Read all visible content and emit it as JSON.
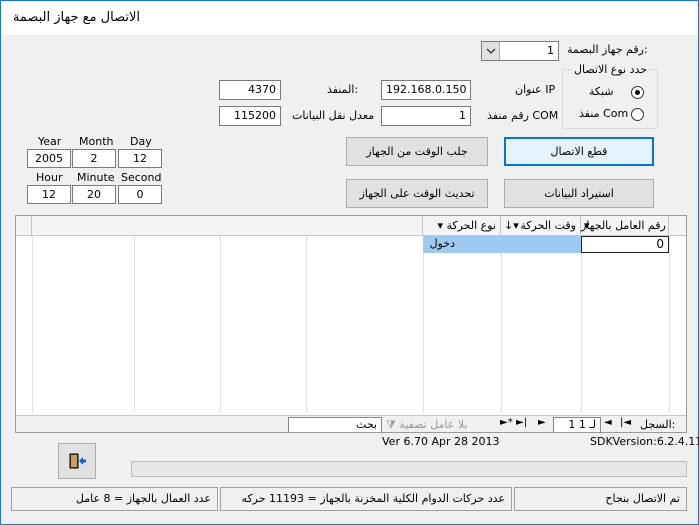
{
  "window": {
    "title": "الاتصال مع جهاز البصمة"
  },
  "device": {
    "label": "رقم جهاز البصمة:",
    "value": "1"
  },
  "connection_type": {
    "group_label": "حدد نوع الاتصال",
    "network_label": "شبكة",
    "com_label": "منفذ Com",
    "selected": "network"
  },
  "network": {
    "ip_label": "عنوان IP",
    "ip_value": "192.168.0.150",
    "port_label": "المنفذ:",
    "port_value": "4370",
    "com_port_label": "رقم منفذ COM",
    "com_port_value": "1",
    "baud_label": "معدل نقل البيانات",
    "baud_value": "115200"
  },
  "datetime": {
    "year_label": "Year",
    "month_label": "Month",
    "day_label": "Day",
    "year": "2005",
    "month": "2",
    "day": "12",
    "hour_label": "Hour",
    "minute_label": "Minute",
    "second_label": "Second",
    "hour": "12",
    "minute": "20",
    "second": "0"
  },
  "buttons": {
    "get_time": "جلب الوقت من الجهاز",
    "disconnect": "قطع الاتصال",
    "update_time": "تحديث الوقت على الجهاز",
    "import_data": "استيراد البيانات"
  },
  "grid": {
    "columns": [
      "رقم العامل بالجهاز",
      "وقت الحركة",
      "نوع الحركة"
    ],
    "rows": [
      {
        "employee": "0",
        "time": "",
        "type": "دخول"
      }
    ],
    "nav": {
      "record_label": "السجل:",
      "record_position": "1 لـ 1",
      "filter_label": "بلا عامل تصفية",
      "search_label": "بحث"
    }
  },
  "info": {
    "version": "Ver 6.70 Apr 28 2013",
    "sdk_version": "SDKVersion:6.2.4.11"
  },
  "status": {
    "connected": "تم الاتصال بنجاح",
    "records_count": "عدد حركات الدوام الكلية المخزنة بالجهاز = 11193 حركه",
    "users_count": "عدد العمال بالجهاز = 8 عامل"
  }
}
